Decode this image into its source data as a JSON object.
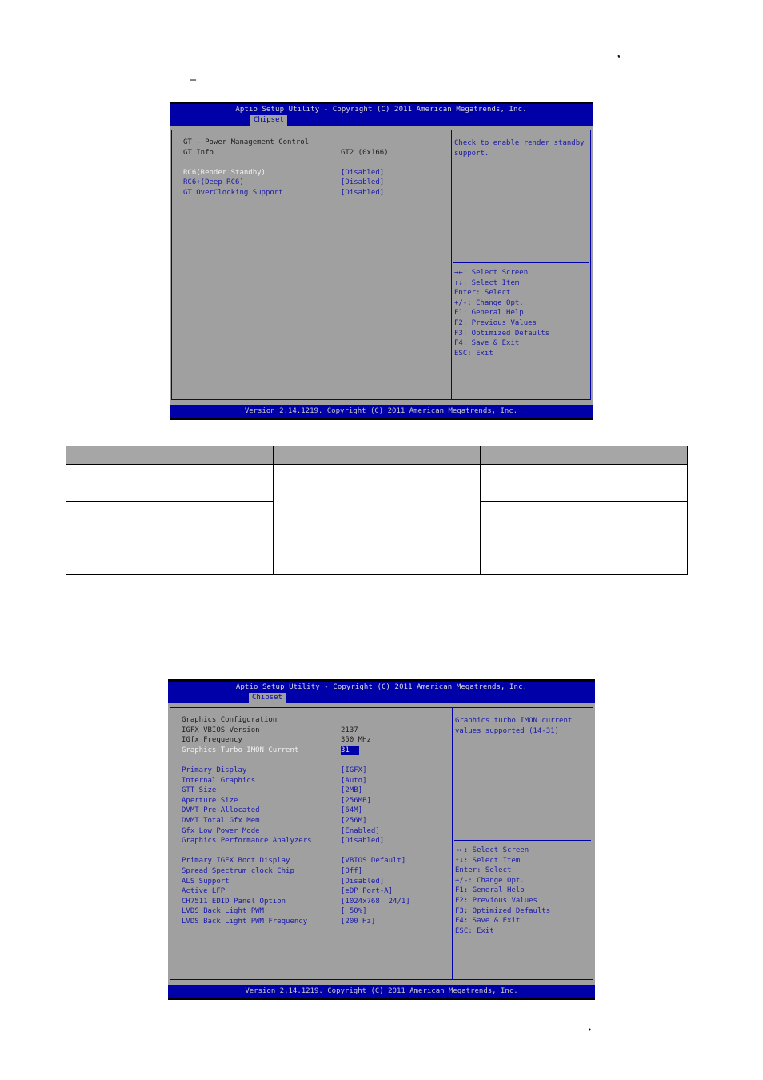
{
  "page_marks": {
    "comma_top": ",",
    "dash_top": "–",
    "comma_bottom": ","
  },
  "screen1": {
    "title": "Aptio Setup Utility - Copyright (C) 2011 American Megatrends, Inc.",
    "tab": "Chipset",
    "items": [
      {
        "label": "GT - Power Management Control",
        "value": "",
        "type": "static"
      },
      {
        "label": "GT Info",
        "value": "GT2 (0x166)",
        "type": "static"
      },
      {
        "label": "",
        "value": "",
        "type": "spacer"
      },
      {
        "label": "RC6(Render Standby)",
        "value": "[Disabled]",
        "type": "selected"
      },
      {
        "label": "RC6+(Deep RC6)",
        "value": "[Disabled]",
        "type": "link"
      },
      {
        "label": "GT OverClocking Support",
        "value": "[Disabled]",
        "type": "link"
      }
    ],
    "help_text": "Check to enable render standby\nsupport.",
    "keys": [
      "→←: Select Screen",
      "↑↓: Select Item",
      "Enter: Select",
      "+/-: Change Opt.",
      "F1: General Help",
      "F2: Previous Values",
      "F3: Optimized Defaults",
      "F4: Save & Exit",
      "ESC: Exit"
    ],
    "footer": "Version 2.14.1219. Copyright (C) 2011 American Megatrends, Inc."
  },
  "table": {
    "headers": [
      "",
      "",
      ""
    ],
    "rows": [
      [
        "",
        "",
        ""
      ],
      [
        "",
        "",
        ""
      ],
      [
        "",
        "",
        ""
      ]
    ]
  },
  "screen2": {
    "title": "Aptio Setup Utility - Copyright (C) 2011 American Megatrends, Inc.",
    "tab": "Chipset",
    "items": [
      {
        "label": "Graphics Configuration",
        "value": "",
        "type": "static"
      },
      {
        "label": "IGFX VBIOS Version",
        "value": "2137",
        "type": "static"
      },
      {
        "label": "IGfx Frequency",
        "value": "350 MHz",
        "type": "static"
      },
      {
        "label": "Graphics Turbo IMON Current",
        "value": "31",
        "type": "selected-highlight"
      },
      {
        "label": "",
        "value": "",
        "type": "spacer"
      },
      {
        "label": "Primary Display",
        "value": "[IGFX]",
        "type": "link"
      },
      {
        "label": "Internal Graphics",
        "value": "[Auto]",
        "type": "link"
      },
      {
        "label": "GTT Size",
        "value": "[2MB]",
        "type": "link"
      },
      {
        "label": "Aperture Size",
        "value": "[256MB]",
        "type": "link"
      },
      {
        "label": "DVMT Pre-Allocated",
        "value": "[64M]",
        "type": "link"
      },
      {
        "label": "DVMT Total Gfx Mem",
        "value": "[256M]",
        "type": "link"
      },
      {
        "label": "Gfx Low Power Mode",
        "value": "[Enabled]",
        "type": "link"
      },
      {
        "label": "Graphics Performance Analyzers",
        "value": "[Disabled]",
        "type": "link"
      },
      {
        "label": "",
        "value": "",
        "type": "spacer"
      },
      {
        "label": "Primary IGFX Boot Display",
        "value": "[VBIOS Default]",
        "type": "link"
      },
      {
        "label": "Spread Spectrum clock Chip",
        "value": "[Off]",
        "type": "link"
      },
      {
        "label": "ALS Support",
        "value": "[Disabled]",
        "type": "link"
      },
      {
        "label": "Active LFP",
        "value": "[eDP Port-A]",
        "type": "link"
      },
      {
        "label": "CH7511 EDID Panel Option",
        "value": "[1024x768  24/1]",
        "type": "link"
      },
      {
        "label": "LVDS Back Light PWM",
        "value": "[ 50%]",
        "type": "link"
      },
      {
        "label": "LVDS Back Light PWM Frequency",
        "value": "[200 Hz]",
        "type": "link"
      }
    ],
    "help_text": "Graphics turbo IMON current\nvalues supported (14-31)",
    "keys": [
      "→←: Select Screen",
      "↑↓: Select Item",
      "Enter: Select",
      "+/-: Change Opt.",
      "F1: General Help",
      "F2: Previous Values",
      "F3: Optimized Defaults",
      "F4: Save & Exit",
      "ESC: Exit"
    ],
    "footer": "Version 2.14.1219. Copyright (C) 2011 American Megatrends, Inc."
  }
}
